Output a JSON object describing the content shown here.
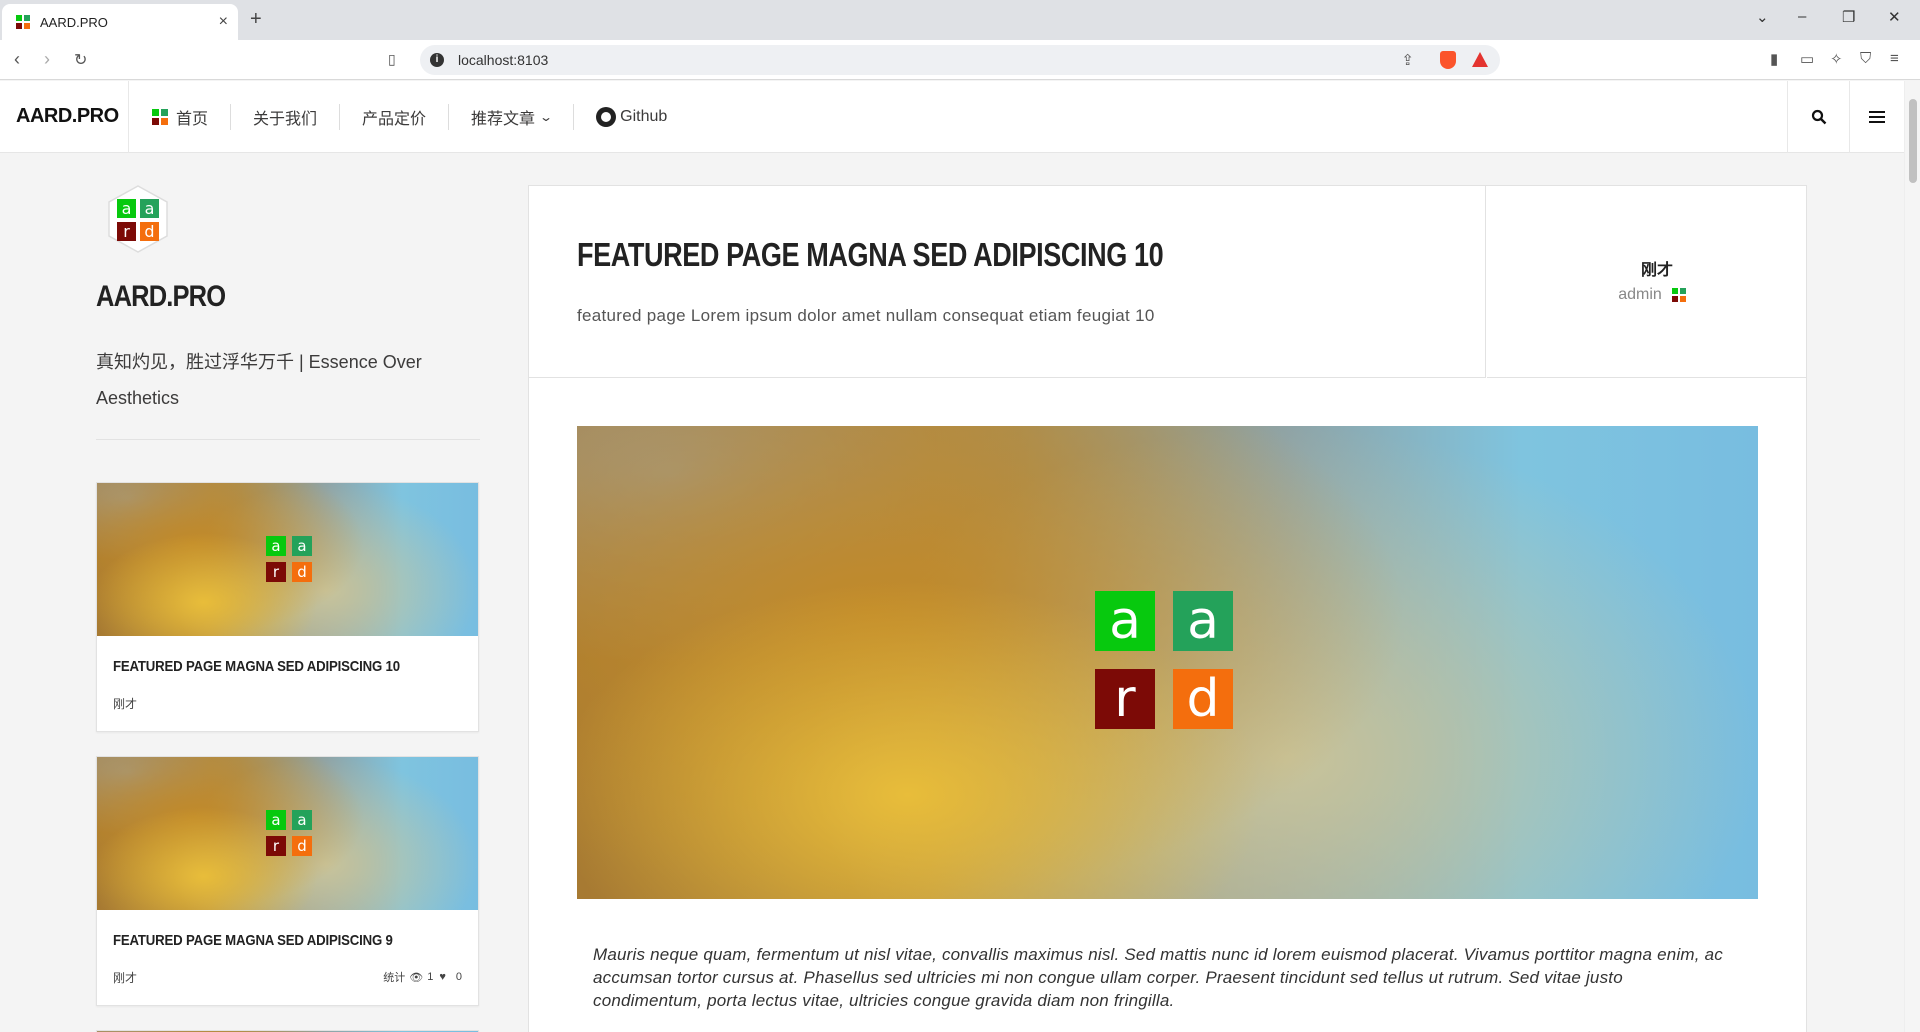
{
  "browser": {
    "tab_title": "AARD.PRO",
    "tab_close": "×",
    "new_tab": "+",
    "url": "localhost:8103",
    "win_min": "–",
    "win_max": "❐",
    "win_close": "✕",
    "tab_dropdown": "⌄"
  },
  "header": {
    "logo": "AARD.PRO",
    "menu": [
      {
        "label": "首页"
      },
      {
        "label": "关于我们"
      },
      {
        "label": "产品定价"
      },
      {
        "label": "推荐文章"
      },
      {
        "label": "Github"
      }
    ]
  },
  "sidebar": {
    "title": "AARD.PRO",
    "description": "真知灼见，胜过浮华万千 | Essence Over Aesthetics",
    "posts": [
      {
        "title": "FEATURED PAGE MAGNA SED ADIPISCING 10",
        "time": "刚才"
      },
      {
        "title": "FEATURED PAGE MAGNA SED ADIPISCING 9",
        "time": "刚才",
        "stats_label": "统计",
        "views": "1",
        "likes": "0"
      }
    ]
  },
  "article": {
    "title": "FEATURED PAGE MAGNA SED ADIPISCING 10",
    "subtitle": "featured page Lorem ipsum dolor amet nullam consequat etiam feugiat 10",
    "time": "刚才",
    "author": "admin",
    "body": "Mauris neque quam, fermentum ut nisl vitae, convallis maximus nisl. Sed mattis nunc id lorem euismod placerat. Vivamus porttitor magna enim, ac accumsan tortor cursus at. Phasellus sed ultricies mi non congue ullam corper. Praesent tincidunt sed tellus ut rutrum. Sed vitae justo condimentum, porta lectus vitae, ultricies congue gravida diam non fringilla."
  },
  "logo_letters": [
    "a",
    "a",
    "r",
    "d"
  ],
  "colors": {
    "logo_a1": "#07c90e",
    "logo_a2": "#24a25a",
    "logo_r": "#7c0a06",
    "logo_d": "#f46e0d"
  }
}
